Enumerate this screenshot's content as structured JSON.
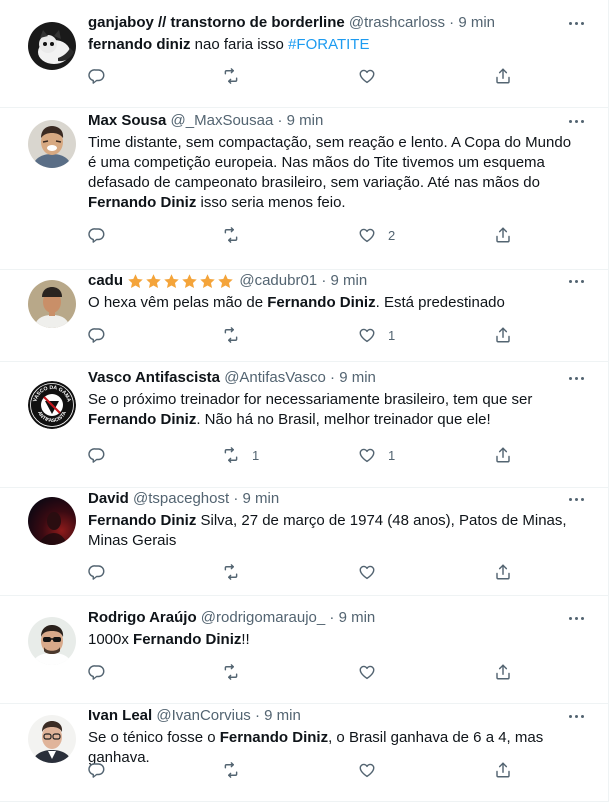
{
  "tweets": [
    {
      "name": "ganjaboy // transtorno de borderline",
      "handle": "@trashcarloss",
      "time": "9 min",
      "text_parts": [
        {
          "t": "fernando diniz",
          "s": "bold"
        },
        {
          "t": " nao faria isso ",
          "s": "plain"
        },
        {
          "t": "#FORATITE",
          "s": "link"
        }
      ],
      "replies": "",
      "retweets": "",
      "likes": "",
      "avatar": "cat"
    },
    {
      "name": "Max Sousa",
      "handle": "@_MaxSousaa",
      "time": "9 min",
      "text_parts": [
        {
          "t": "Time distante, sem compactação, sem reação e lento. A Copa do Mundo é uma competição europeia. Nas mãos do Tite tivemos um esquema defasado de campeonato brasileiro, sem variação. Até nas mãos do ",
          "s": "plain"
        },
        {
          "t": "Fernando Diniz",
          "s": "bold"
        },
        {
          "t": " isso seria menos feio.",
          "s": "plain"
        }
      ],
      "replies": "",
      "retweets": "",
      "likes": "2",
      "avatar": "man-laugh"
    },
    {
      "name": "cadu",
      "name_stars": 6,
      "handle": "@cadubr01",
      "time": "9 min",
      "text_parts": [
        {
          "t": "O hexa vêm pelas mão de ",
          "s": "plain"
        },
        {
          "t": "Fernando Diniz",
          "s": "bold"
        },
        {
          "t": ". Está predestinado",
          "s": "plain"
        }
      ],
      "replies": "",
      "retweets": "",
      "likes": "1",
      "avatar": "man-cap"
    },
    {
      "name": "Vasco Antifascista",
      "handle": "@AntifasVasco",
      "time": "9 min",
      "text_parts": [
        {
          "t": "Se o próximo treinador for necessariamente brasileiro, tem que ser ",
          "s": "plain"
        },
        {
          "t": "Fernando Diniz",
          "s": "bold"
        },
        {
          "t": ". Não há no Brasil, melhor treinador que ele!",
          "s": "plain"
        }
      ],
      "replies": "",
      "retweets": "1",
      "likes": "1",
      "avatar": "vasco-logo",
      "avatar_text_top": "VASCO DA GAMA",
      "avatar_text_bottom": "ANTIFASCISTA"
    },
    {
      "name": "David",
      "handle": "@tspaceghost",
      "time": "9 min",
      "text_parts": [
        {
          "t": "Fernando Diniz",
          "s": "bold"
        },
        {
          "t": " Silva, 27 de março de 1974 (48 anos), Patos de Minas, Minas Gerais",
          "s": "plain"
        }
      ],
      "replies": "",
      "retweets": "",
      "likes": "",
      "avatar": "dark-red"
    },
    {
      "name": "Rodrigo Araújo",
      "handle": "@rodrigomaraujo_",
      "time": "9 min",
      "text_parts": [
        {
          "t": "1000x ",
          "s": "plain"
        },
        {
          "t": "Fernando Diniz",
          "s": "bold"
        },
        {
          "t": "!!",
          "s": "plain"
        }
      ],
      "replies": "",
      "retweets": "",
      "likes": "",
      "avatar": "man-sunglasses"
    },
    {
      "name": "Ivan Leal",
      "handle": "@IvanCorvius",
      "time": "9 min",
      "text_parts": [
        {
          "t": "Se o ténico fosse o ",
          "s": "plain"
        },
        {
          "t": "Fernando Diniz",
          "s": "bold"
        },
        {
          "t": ", o Brasil ganhava de 6 a 4, mas ganhava.",
          "s": "plain"
        }
      ],
      "replies": "",
      "retweets": "",
      "likes": "",
      "avatar": "man-glasses"
    }
  ],
  "ui": {
    "dot": "·",
    "icons": [
      "reply-icon",
      "retweet-icon",
      "like-icon",
      "share-icon",
      "more-icon",
      "star-icon"
    ],
    "colors": {
      "text": "#0f1419",
      "muted": "#536471",
      "link": "#1d9bf0",
      "star": "#f4a43a",
      "divider": "#eff3f4"
    }
  }
}
